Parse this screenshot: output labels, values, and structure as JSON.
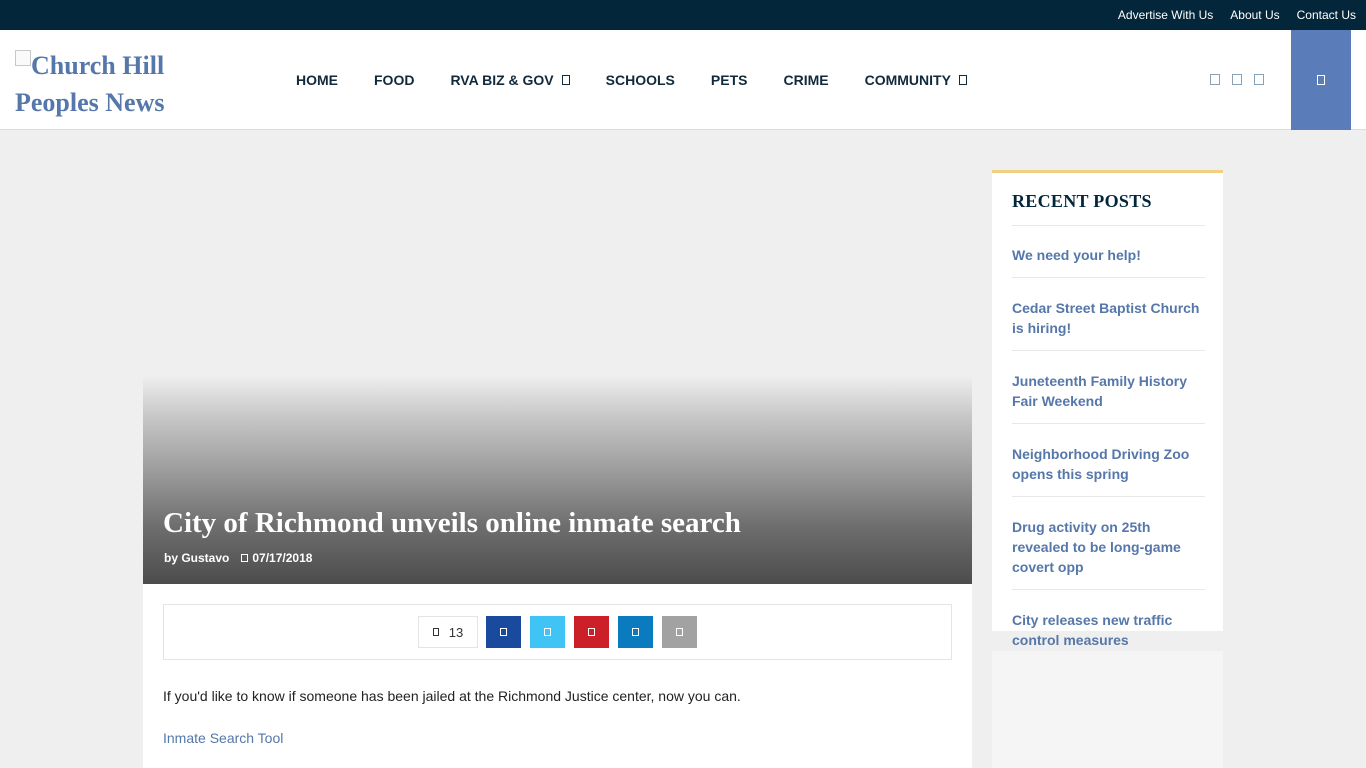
{
  "topbar": {
    "links": [
      "Advertise With Us",
      "About Us",
      "Contact Us"
    ]
  },
  "header": {
    "logo_alt": "Church Hill Peoples News Logo",
    "nav": [
      {
        "label": "HOME",
        "dropdown": false
      },
      {
        "label": "FOOD",
        "dropdown": false
      },
      {
        "label": "RVA BIZ & GOV",
        "dropdown": true
      },
      {
        "label": "SCHOOLS",
        "dropdown": false
      },
      {
        "label": "PETS",
        "dropdown": false
      },
      {
        "label": "CRIME",
        "dropdown": false
      },
      {
        "label": "COMMUNITY",
        "dropdown": true
      }
    ],
    "social_icons": [
      "facebook-icon",
      "twitter-icon",
      "instagram-icon"
    ],
    "search_icon": "search-icon"
  },
  "article": {
    "title": "City of Richmond unveils online inmate search",
    "author": "by Gustavo",
    "date": "07/17/2018",
    "share_count": "13",
    "share_buttons": [
      {
        "name": "facebook",
        "color": "#1a4a9e"
      },
      {
        "name": "twitter",
        "color": "#40c4f5"
      },
      {
        "name": "pinterest",
        "color": "#cb2027"
      },
      {
        "name": "linkedin",
        "color": "#0a7bbe"
      },
      {
        "name": "email",
        "color": "#a2a2a2"
      }
    ],
    "body": "If you'd like to know if someone has been jailed at the Richmond Justice center, now you can.",
    "link_text": "Inmate Search Tool"
  },
  "sidebar": {
    "title": "RECENT POSTS",
    "posts": [
      "We need your help!",
      "Cedar Street Baptist Church is hiring!",
      "Juneteenth Family History Fair Weekend",
      "Neighborhood Driving Zoo opens this spring",
      "Drug activity on 25th revealed to be long-game covert opp",
      "City releases new traffic control measures"
    ]
  },
  "colors": {
    "topbar": "#03263a",
    "accent": "#5a7dba",
    "link": "#5577aa",
    "widget_border": "#f0cf7f"
  }
}
